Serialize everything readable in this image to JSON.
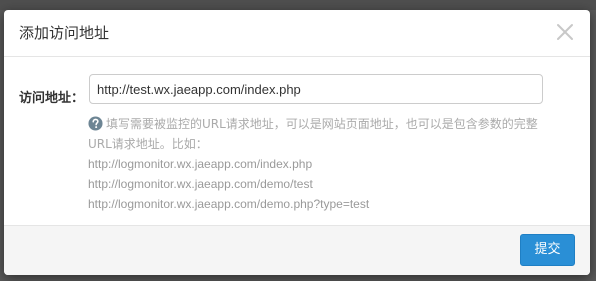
{
  "colors": {
    "accent": "#2a8fd6",
    "help_icon": "#6d8594",
    "help_text": "#aaaaaa"
  },
  "dialog": {
    "title": "添加访问地址",
    "close_icon": "close-icon"
  },
  "form": {
    "url_label": "访问地址：",
    "url_value": "http://test.wx.jaeapp.com/index.php",
    "help_icon": "question-circle-icon",
    "help_line_1": "填写需要被监控的URL请求地址，可以是网站页面地址，也可以是包含参数的完整",
    "help_line_2": "URL请求地址。比如：",
    "examples": [
      "http://logmonitor.wx.jaeapp.com/index.php",
      "http://logmonitor.wx.jaeapp.com/demo/test",
      "http://logmonitor.wx.jaeapp.com/demo.php?type=test"
    ]
  },
  "footer": {
    "submit_label": "提交"
  }
}
